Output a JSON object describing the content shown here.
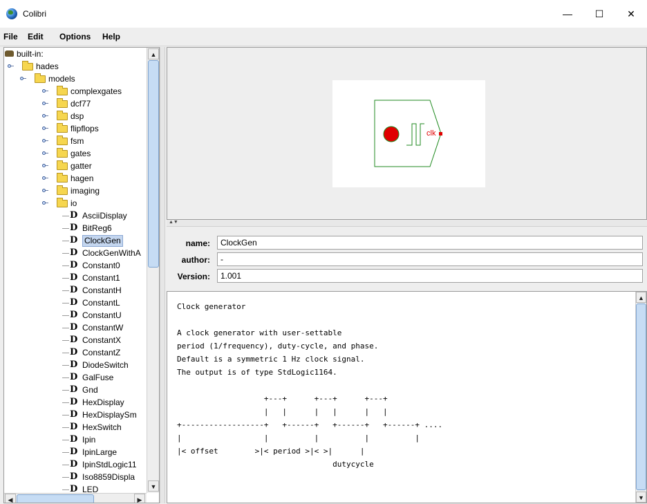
{
  "window": {
    "title": "Colibri",
    "controls": {
      "minimize": "—",
      "maximize": "☐",
      "close": "✕"
    }
  },
  "menu": [
    "File",
    "Edit",
    "Options",
    "Help"
  ],
  "tree": {
    "root": "built-in:",
    "level1": "hades",
    "level2": "models",
    "folders": [
      "complexgates",
      "dcf77",
      "dsp",
      "flipflops",
      "fsm",
      "gates",
      "gatter",
      "hagen",
      "imaging",
      "io"
    ],
    "io_items": [
      "AsciiDisplay",
      "BitReg6",
      "ClockGen",
      "ClockGenWithA",
      "Constant0",
      "Constant1",
      "ConstantH",
      "ConstantL",
      "ConstantU",
      "ConstantW",
      "ConstantX",
      "ConstantZ",
      "DiodeSwitch",
      "GalFuse",
      "Gnd",
      "HexDisplay",
      "HexDisplaySm",
      "HexSwitch",
      "Ipin",
      "IpinLarge",
      "IpinStdLogic11",
      "Iso8859Displa",
      "LED"
    ],
    "selected": "ClockGen",
    "node_icon": "D"
  },
  "preview": {
    "pin_label": "clk"
  },
  "form": {
    "name_label": "name:",
    "name_value": "ClockGen",
    "author_label": "author:",
    "author_value": "-",
    "version_label": "Version:",
    "version_value": "1.001"
  },
  "description": "Clock generator\n\nA clock generator with user-settable\nperiod (1/frequency), duty-cycle, and phase.\nDefault is a symmetric 1 Hz clock signal.\nThe output is of type StdLogic1164.\n\n                   +---+      +---+      +---+\n                   |   |      |   |      |   |\n+------------------+   +------+   +------+   +------+ ....\n|                  |          |          |          |\n|< offset        >|< period >|< >|      |\n                                  dutycycle",
  "colors": {
    "accent": "#c4d6ef",
    "symbol_border": "#1f8a1f",
    "led": "#e00000"
  }
}
